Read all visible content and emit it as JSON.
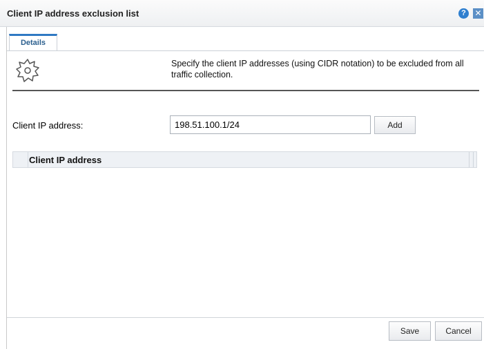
{
  "dialog": {
    "title": "Client IP address exclusion list",
    "help_glyph": "?",
    "close_glyph": "✕"
  },
  "tabs": [
    {
      "label": "Details",
      "active": true
    }
  ],
  "details": {
    "description": "Specify the client IP addresses (using CIDR notation) to be excluded from all traffic collection.",
    "icon": "gear-icon"
  },
  "form": {
    "ip_label": "Client IP address:",
    "ip_value": "198.51.100.1/24",
    "add_label": "Add"
  },
  "table": {
    "columns": [
      "Client IP address"
    ],
    "rows": []
  },
  "footer": {
    "save_label": "Save",
    "cancel_label": "Cancel"
  },
  "colors": {
    "accent": "#2f79c3",
    "header_bg": "#eef1f5"
  }
}
